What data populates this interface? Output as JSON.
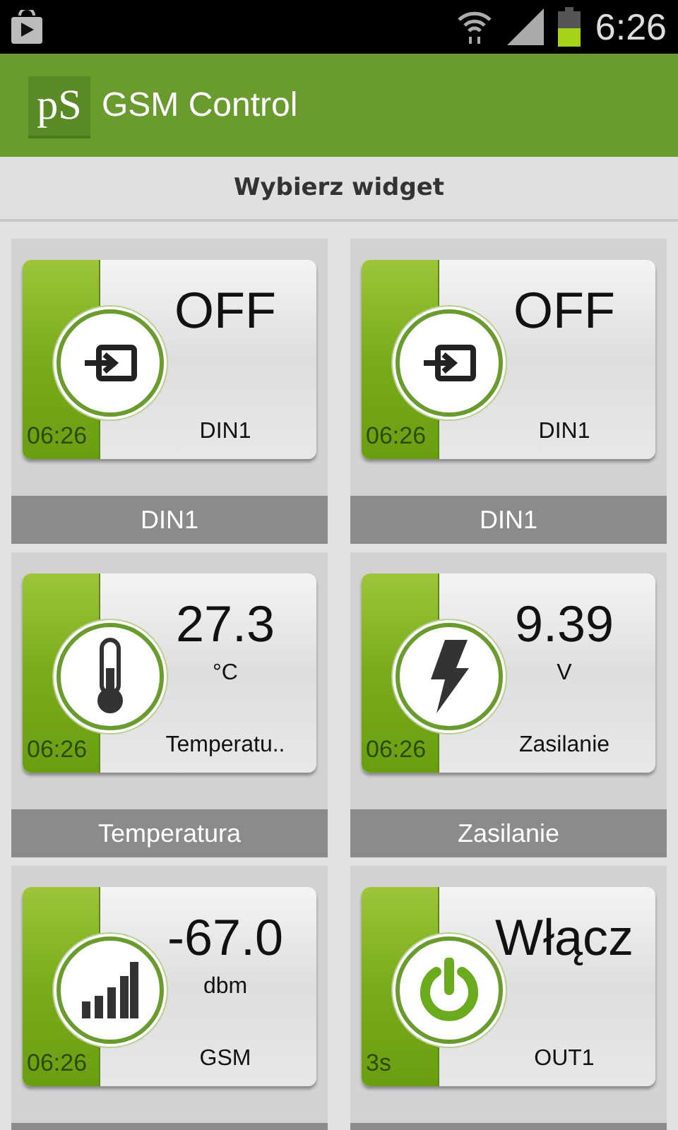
{
  "status_bar": {
    "time": "6:26"
  },
  "app_bar": {
    "logo": "pS",
    "title": "GSM Control"
  },
  "header": {
    "title": "Wybierz widget"
  },
  "widgets": [
    {
      "kind": "input",
      "value": "OFF",
      "label": "DIN1",
      "time": "06:26",
      "caption": "DIN1"
    },
    {
      "kind": "input",
      "value": "OFF",
      "label": "DIN1",
      "time": "06:26",
      "caption": "DIN1"
    },
    {
      "kind": "thermometer",
      "value": "27.3",
      "unit": "°C",
      "label": "Temperatu..",
      "time": "06:26",
      "caption": "Temperatura"
    },
    {
      "kind": "bolt",
      "value": "9.39",
      "unit": "V",
      "label": "Zasilanie",
      "time": "06:26",
      "caption": "Zasilanie"
    },
    {
      "kind": "signal",
      "value": "-67.0",
      "unit": "dbm",
      "label": "GSM",
      "time": "06:26"
    },
    {
      "kind": "power",
      "value": "Włącz",
      "label": "OUT1",
      "time": "3s"
    }
  ]
}
